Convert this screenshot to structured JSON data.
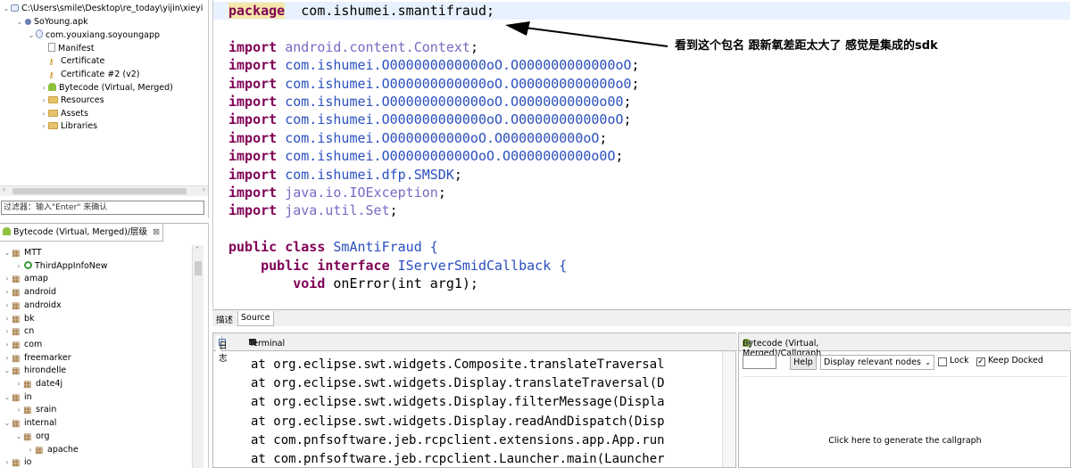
{
  "project_tree": {
    "root_path": "C:\\Users\\smile\\Desktop\\re_today\\yijin\\xieyi",
    "apk": "SoYoung.apk",
    "package": "com.youxiang.soyoungapp",
    "items": [
      "Manifest",
      "Certificate",
      "Certificate #2 (v2)",
      "Bytecode (Virtual, Merged)",
      "Resources",
      "Assets",
      "Libraries"
    ],
    "filter_placeholder": "过滤器：输入\"Enter\" 来确认"
  },
  "hierarchy": {
    "tab_label": "Bytecode (Virtual, Merged)/层级",
    "close": "⊠",
    "items": [
      {
        "label": "MTT",
        "level": 0,
        "expanded": true,
        "icon": "package-grid-icon"
      },
      {
        "label": "ThirdAppInfoNew",
        "level": 1,
        "expanded": false,
        "icon": "class-icon"
      },
      {
        "label": "amap",
        "level": 0,
        "expanded": false,
        "icon": "package-grid-icon"
      },
      {
        "label": "android",
        "level": 0,
        "expanded": false,
        "icon": "package-grid-icon"
      },
      {
        "label": "androidx",
        "level": 0,
        "expanded": false,
        "icon": "package-grid-icon"
      },
      {
        "label": "bk",
        "level": 0,
        "expanded": false,
        "icon": "package-grid-icon"
      },
      {
        "label": "cn",
        "level": 0,
        "expanded": false,
        "icon": "package-grid-icon"
      },
      {
        "label": "com",
        "level": 0,
        "expanded": false,
        "icon": "package-grid-icon"
      },
      {
        "label": "freemarker",
        "level": 0,
        "expanded": false,
        "icon": "package-grid-icon"
      },
      {
        "label": "hirondelle",
        "level": 0,
        "expanded": true,
        "icon": "package-grid-icon"
      },
      {
        "label": "date4j",
        "level": 1,
        "expanded": false,
        "icon": "package-grid-icon"
      },
      {
        "label": "in",
        "level": 0,
        "expanded": true,
        "icon": "package-grid-icon"
      },
      {
        "label": "srain",
        "level": 1,
        "expanded": false,
        "icon": "package-grid-icon"
      },
      {
        "label": "internal",
        "level": 0,
        "expanded": true,
        "icon": "package-grid-icon"
      },
      {
        "label": "org",
        "level": 1,
        "expanded": true,
        "icon": "package-grid-icon"
      },
      {
        "label": "apache",
        "level": 2,
        "expanded": false,
        "icon": "package-grid-icon"
      },
      {
        "label": "io",
        "level": 0,
        "expanded": false,
        "icon": "package-grid-icon"
      }
    ]
  },
  "editor": {
    "lines": [
      {
        "kw": "package",
        "rest": " com.ishumei.smantifraud;",
        "type": "package"
      },
      {
        "kw": "",
        "rest": "",
        "type": "blank"
      },
      {
        "kw": "import",
        "rest": "android.content.Context",
        "type": "import-gray"
      },
      {
        "kw": "import",
        "rest": "com.ishumei.O000000000000oO.O000000000000oO",
        "type": "import-blue"
      },
      {
        "kw": "import",
        "rest": "com.ishumei.O000000000000oO.O000000000000o0",
        "type": "import-blue"
      },
      {
        "kw": "import",
        "rest": "com.ishumei.O000000000000oO.O0000000000o00",
        "type": "import-blue"
      },
      {
        "kw": "import",
        "rest": "com.ishumei.O000000000000oO.O00000000000oO",
        "type": "import-blue"
      },
      {
        "kw": "import",
        "rest": "com.ishumei.O0000000000oO.O0000000000oO",
        "type": "import-blue"
      },
      {
        "kw": "import",
        "rest": "com.ishumei.O0000000000OoO.O0000000000o0O",
        "type": "import-blue"
      },
      {
        "kw": "import",
        "rest": "com.ishumei.dfp.SMSDK",
        "type": "import-blue"
      },
      {
        "kw": "import",
        "rest": "java.io.IOException",
        "type": "import-gray"
      },
      {
        "kw": "import",
        "rest": "java.util.Set",
        "type": "import-gray"
      },
      {
        "kw": "",
        "rest": "",
        "type": "blank"
      },
      {
        "kw": "public class",
        "rest": "SmAntiFraud {",
        "type": "class"
      },
      {
        "kw": "public interface",
        "rest": "IServerSmidCallback {",
        "type": "interface"
      },
      {
        "kw": "void",
        "rest": "onError(int arg1);",
        "type": "method"
      }
    ],
    "annotation": "看到这个包名 跟新氧差距太大了  感觉是集成的sdk",
    "tabs": [
      "描述",
      "Source"
    ]
  },
  "console": {
    "tabs": [
      "日志",
      "Terminal"
    ],
    "lines": [
      "at org.eclipse.swt.widgets.Composite.translateTraversal",
      "at org.eclipse.swt.widgets.Display.translateTraversal(D",
      "at org.eclipse.swt.widgets.Display.filterMessage(Displa",
      "at org.eclipse.swt.widgets.Display.readAndDispatch(Disp",
      "at com.pnfsoftware.jeb.rcpclient.extensions.app.App.run",
      "at com.pnfsoftware.jeb.rcpclient.Launcher.main(Launcher"
    ]
  },
  "callgraph": {
    "tab_label": "Bytecode (Virtual, Merged)/Callgraph",
    "help_label": "Help",
    "select_value": "Display relevant nodes",
    "lock_label": "Lock",
    "lock_checked": false,
    "keep_docked_label": "Keep Docked",
    "keep_docked_checked": true,
    "message": "Click here to generate the callgraph"
  },
  "colors": {
    "keyword": "#7f0055",
    "import_blue": "#2a4fbf",
    "import_gray": "#7b69c4",
    "current_line": "#e8f2fe"
  }
}
